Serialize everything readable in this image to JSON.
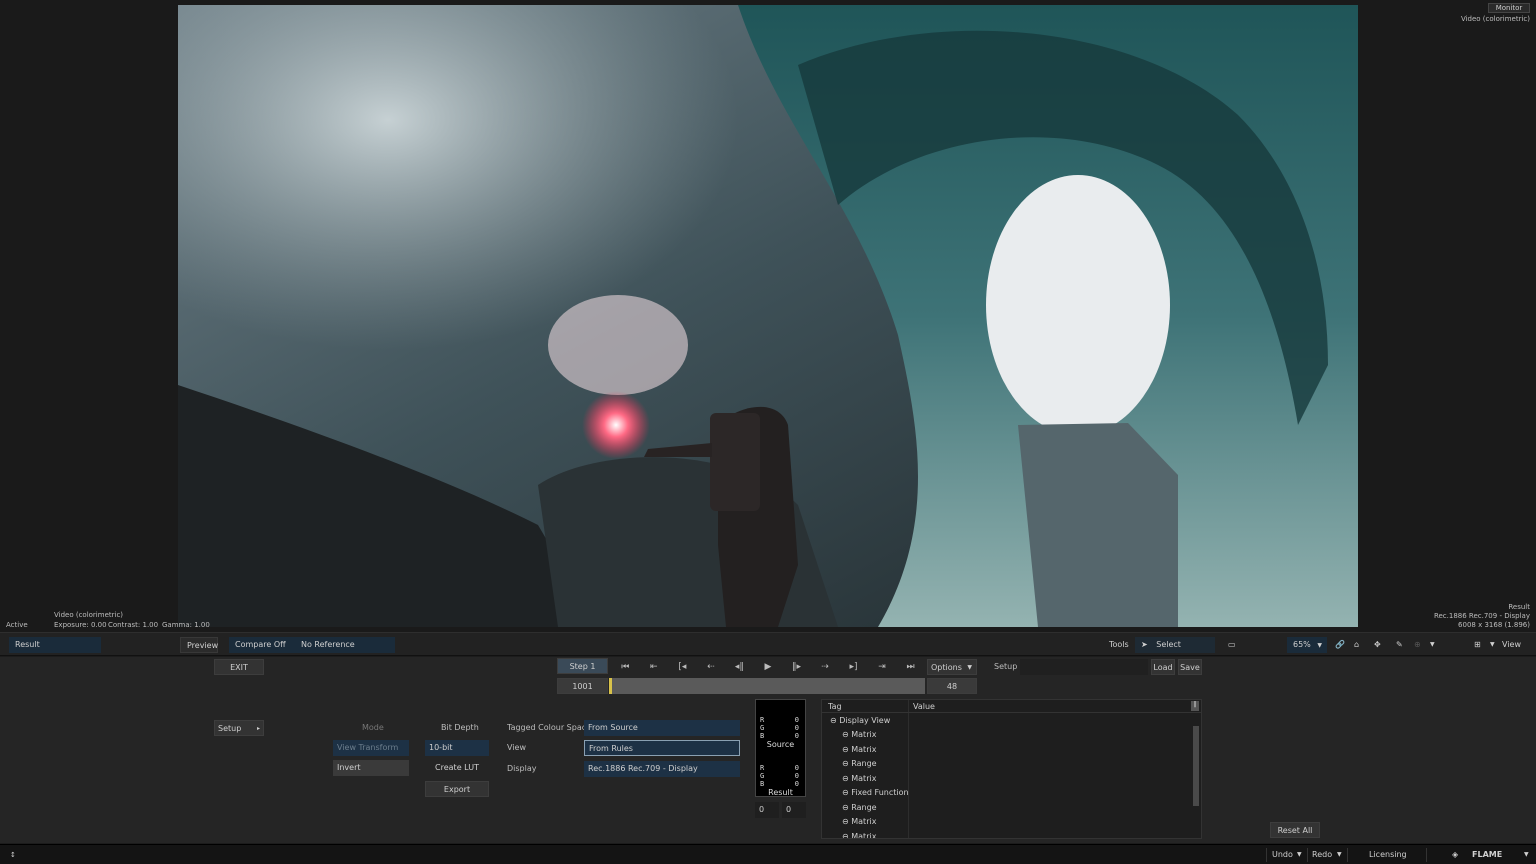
{
  "viewer": {
    "monitor_label": "Monitor",
    "top_right_mode": "Video (colorimetric)",
    "left_overlay": {
      "active": "Active",
      "mode": "Video (colorimetric)",
      "exposure": "Exposure: 0.00",
      "contrast": "Contrast: 1.00",
      "gamma": "Gamma: 1.00"
    },
    "right_overlay": {
      "result": "Result",
      "display": "Rec.1886 Rec.709 - Display",
      "resolution": "6008 x 3168 (1.896)"
    }
  },
  "toolbar": {
    "result": "Result",
    "preview": "Preview",
    "compare": "Compare Off",
    "reference": "No Reference",
    "tools": "Tools",
    "select": "Select",
    "zoom": "65%",
    "view": "View"
  },
  "panel": {
    "exit": "EXIT",
    "step": "Step 1",
    "frame_start": "1001",
    "frame_end": "48",
    "options": "Options",
    "setup_label": "Setup",
    "load": "Load",
    "save": "Save",
    "setup_menu": "Setup",
    "mode_label": "Mode",
    "mode_view_transform": "View Transform",
    "mode_invert": "Invert",
    "bit_depth_label": "Bit Depth",
    "bit_depth_value": "10-bit",
    "create_lut": "Create LUT",
    "export": "Export",
    "tagged_colour_space_label": "Tagged Colour Space",
    "tagged_colour_space_value": "From Source",
    "view_label": "View",
    "view_value": "From Rules",
    "display_label": "Display",
    "display_value": "Rec.1886 Rec.709 - Display",
    "reset_all": "Reset All"
  },
  "rgb_readout": {
    "source": {
      "title": "Source",
      "r": "0",
      "g": "0",
      "b": "0"
    },
    "result": {
      "title": "Result",
      "r": "0",
      "g": "0",
      "b": "0"
    },
    "coord_x": "0",
    "coord_y": "0"
  },
  "tree": {
    "col_tag": "Tag",
    "col_value": "Value",
    "root": "Display View",
    "items": [
      "Matrix",
      "Matrix",
      "Range",
      "Matrix",
      "Fixed Function",
      "Range",
      "Matrix",
      "Matrix"
    ]
  },
  "statusbar": {
    "undo": "Undo",
    "redo": "Redo",
    "licensing": "Licensing",
    "app": "FLAME"
  },
  "colors": {
    "accent_selected": "#1d3145",
    "scrub_marker": "#d8c24a",
    "flare": "#ff3a5c"
  }
}
